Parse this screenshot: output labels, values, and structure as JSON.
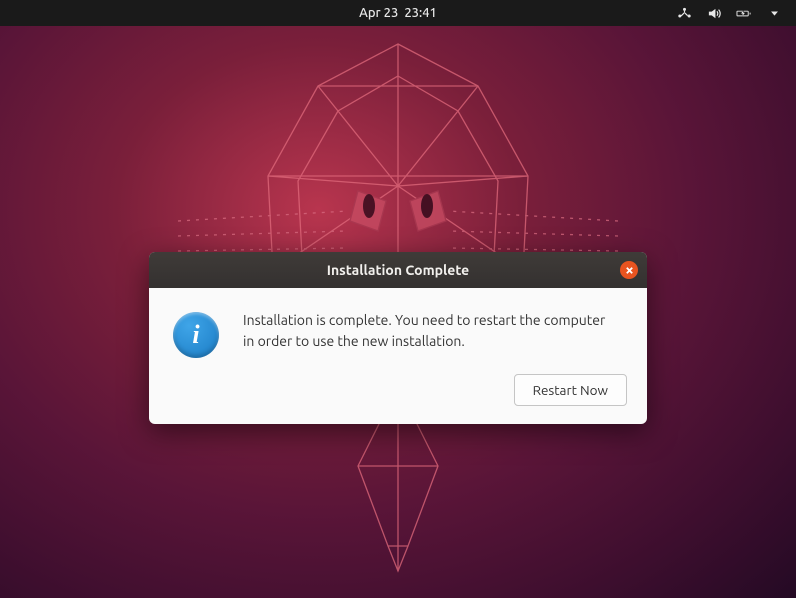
{
  "topbar": {
    "date": "Apr 23",
    "time": "23:41"
  },
  "dialog": {
    "title": "Installation Complete",
    "message": "Installation is complete. You need to restart the computer in order to use the new installation.",
    "restart_label": "Restart Now"
  }
}
